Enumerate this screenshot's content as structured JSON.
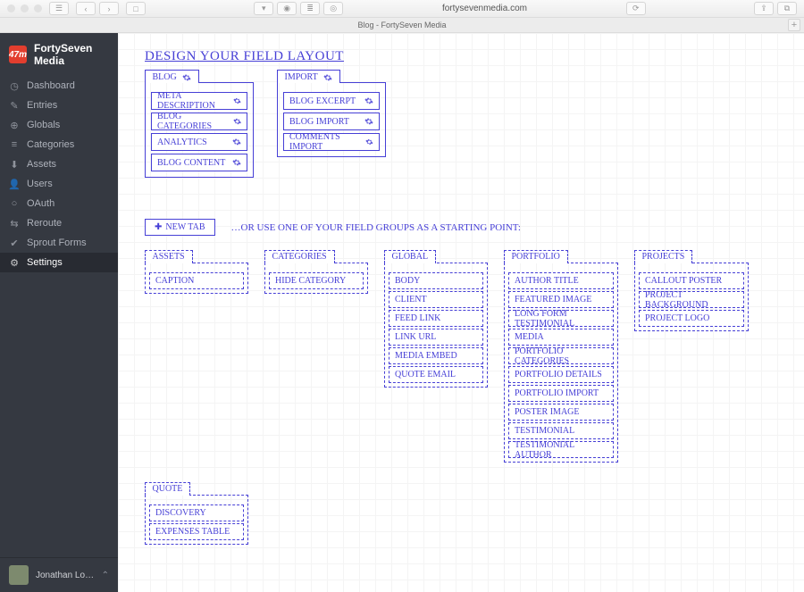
{
  "browser": {
    "url": "fortysevenmedia.com",
    "tab_title": "Blog - FortySeven Media"
  },
  "sidebar": {
    "brand": "FortySeven Media",
    "badge": "47m",
    "items": [
      {
        "label": "Dashboard",
        "icon": "gauge-icon"
      },
      {
        "label": "Entries",
        "icon": "pencil-icon"
      },
      {
        "label": "Globals",
        "icon": "globe-icon"
      },
      {
        "label": "Categories",
        "icon": "list-icon"
      },
      {
        "label": "Assets",
        "icon": "download-icon"
      },
      {
        "label": "Users",
        "icon": "user-icon"
      },
      {
        "label": "OAuth",
        "icon": "circle-icon"
      },
      {
        "label": "Reroute",
        "icon": "route-icon"
      },
      {
        "label": "Sprout Forms",
        "icon": "check-icon"
      },
      {
        "label": "Settings",
        "icon": "gear-icon"
      }
    ],
    "active_index": 9,
    "footer_user": "Jonathan Longn…"
  },
  "page": {
    "title": "DESIGN YOUR FIELD LAYOUT",
    "layout_tabs": [
      {
        "name": "BLOG",
        "fields": [
          "META DESCRIPTION",
          "BLOG CATEGORIES",
          "ANALYTICS",
          "BLOG CONTENT"
        ]
      },
      {
        "name": "IMPORT",
        "fields": [
          "BLOG EXCERPT",
          "BLOG IMPORT",
          "COMMENTS IMPORT"
        ]
      }
    ],
    "new_tab_label": "NEW TAB",
    "hint": "…OR USE ONE OF YOUR FIELD GROUPS AS A STARTING POINT:",
    "groups": [
      {
        "name": "ASSETS",
        "w": 116,
        "fields": [
          "CAPTION"
        ]
      },
      {
        "name": "CATEGORIES",
        "w": 116,
        "fields": [
          "HIDE CATEGORY"
        ]
      },
      {
        "name": "GLOBAL",
        "w": 116,
        "fields": [
          "BODY",
          "CLIENT",
          "FEED LINK",
          "LINK URL",
          "MEDIA EMBED",
          "QUOTE EMAIL"
        ]
      },
      {
        "name": "PORTFOLIO",
        "w": 128,
        "fields": [
          "AUTHOR TITLE",
          "FEATURED IMAGE",
          "LONG FORM TESTIMONIAL",
          "MEDIA",
          "PORTFOLIO CATEGORIES",
          "PORTFOLIO DETAILS",
          "PORTFOLIO IMPORT",
          "POSTER IMAGE",
          "TESTIMONIAL",
          "TESTIMONIAL AUTHOR"
        ]
      },
      {
        "name": "PROJECTS",
        "w": 128,
        "fields": [
          "CALLOUT POSTER",
          "PROJECT BACKGROUND",
          "PROJECT LOGO"
        ]
      }
    ],
    "groups2": [
      {
        "name": "QUOTE",
        "w": 116,
        "fields": [
          "DISCOVERY",
          "EXPENSES TABLE"
        ]
      }
    ]
  }
}
